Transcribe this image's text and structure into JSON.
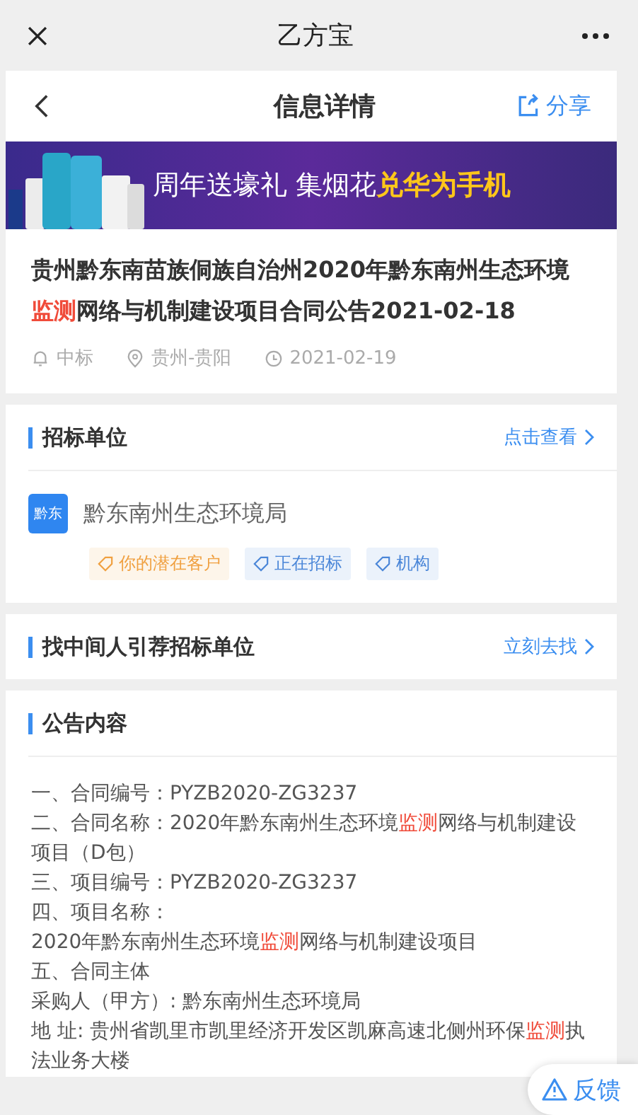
{
  "top_bar": {
    "title": "乙方宝"
  },
  "nav_bar": {
    "title": "信息详情",
    "share": "分享"
  },
  "banner": {
    "text": "周年送壕礼 集烟花",
    "highlight": "兑华为手机"
  },
  "notice": {
    "title": [
      {
        "text": "贵州黔东南苗族侗族自治州2020年黔东南州生态环境",
        "highlight": false
      },
      {
        "text": "监测",
        "highlight": true
      },
      {
        "text": "网络与机制建设项目合同公告2021-02-18",
        "highlight": false
      }
    ],
    "type": "中标",
    "region": "贵州-贵阳",
    "date": "2021-02-19"
  },
  "bidder_section": {
    "heading": "招标单位",
    "link": "点击查看",
    "org_badge": "黔东",
    "org_name": "黔东南州生态环境局",
    "tags": [
      {
        "label": "你的潜在客户",
        "color": "#f0a040"
      },
      {
        "label": "正在招标",
        "color": "#4a86d8"
      },
      {
        "label": "机构",
        "color": "#4a86d8"
      }
    ]
  },
  "referral_section": {
    "heading": "找中间人引荐招标单位",
    "link": "立刻去找"
  },
  "content_section": {
    "heading": "公告内容",
    "paragraphs": [
      [
        {
          "text": "一、合同编号：PYZB2020-ZG3237",
          "highlight": false
        }
      ],
      [
        {
          "text": "二、合同名称：2020年黔东南州生态环境",
          "highlight": false
        },
        {
          "text": "监测",
          "highlight": true
        },
        {
          "text": "网络与机制建设项目（D包）",
          "highlight": false
        }
      ],
      [
        {
          "text": "三、项目编号：PYZB2020-ZG3237",
          "highlight": false
        }
      ],
      [
        {
          "text": "四、项目名称：",
          "highlight": false
        }
      ],
      [
        {
          "text": "2020年黔东南州生态环境",
          "highlight": false
        },
        {
          "text": "监测",
          "highlight": true
        },
        {
          "text": "网络与机制建设项目",
          "highlight": false
        }
      ],
      [
        {
          "text": "五、合同主体",
          "highlight": false
        }
      ],
      [
        {
          "text": "采购人（甲方）: 黔东南州生态环境局",
          "highlight": false
        }
      ],
      [
        {
          "text": "地 址: 贵州省凯里市凯里经济开发区凯麻高速北侧州环保",
          "highlight": false
        },
        {
          "text": "监测",
          "highlight": true
        },
        {
          "text": "执法业务大楼",
          "highlight": false
        }
      ]
    ]
  },
  "feedback_button": "反馈"
}
